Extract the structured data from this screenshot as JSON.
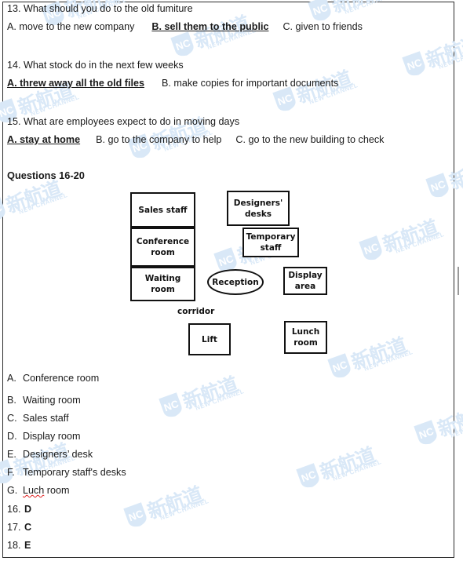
{
  "document": {
    "questions": [
      {
        "number": "13.",
        "stem": "13. What should you do to the old fumiture",
        "options": [
          {
            "label": "A. move to the new company",
            "correct": false
          },
          {
            "label": "B. sell them to the public",
            "correct": true
          },
          {
            "label": "C. given to friends",
            "correct": false
          }
        ]
      },
      {
        "number": "14.",
        "stem": "14. What stock do in the next few weeks",
        "options": [
          {
            "label": "A. threw away all the old files",
            "correct": true
          },
          {
            "label": "B. make copies for important documents",
            "correct": false
          }
        ]
      },
      {
        "number": "15.",
        "stem": "15. What are employees expect to do in moving days",
        "options": [
          {
            "label": "A. stay at home",
            "correct": true
          },
          {
            "label": "B. go to the company to help",
            "correct": false
          },
          {
            "label": "C. go to the new building to check",
            "correct": false
          }
        ]
      }
    ],
    "section_heading": "Questions 16-20",
    "diagram": {
      "boxes": [
        {
          "name": "sales-staff",
          "lines": [
            "Sales staff"
          ]
        },
        {
          "name": "conference-room",
          "lines": [
            "Conference",
            "room"
          ]
        },
        {
          "name": "waiting-room",
          "lines": [
            "Waiting",
            "room"
          ]
        },
        {
          "name": "designers-desks",
          "lines": [
            "Designers'",
            "desks"
          ]
        },
        {
          "name": "temporary-staff",
          "lines": [
            "Temporary",
            "staff"
          ]
        },
        {
          "name": "display-area",
          "lines": [
            "Display",
            "area"
          ]
        },
        {
          "name": "lift",
          "lines": [
            "Lift"
          ]
        },
        {
          "name": "lunch-room",
          "lines": [
            "Lunch",
            "room"
          ]
        }
      ],
      "ellipse": {
        "name": "reception",
        "label": "Reception"
      },
      "corridor_label": "corridor"
    },
    "option_list": [
      {
        "letter": "A.",
        "text": "Conference room"
      },
      {
        "letter": "B.",
        "text": "Waiting room"
      },
      {
        "letter": "C.",
        "text": "Sales staff"
      },
      {
        "letter": "D.",
        "text": "Display room"
      },
      {
        "letter": "E.",
        "text": "Designers’ desk"
      },
      {
        "letter": "F.",
        "text": "Temporary staff's desks"
      },
      {
        "letter": "G.",
        "text_prefix": "",
        "text_misspelled": "Luch",
        "text_suffix": " room"
      }
    ],
    "answers": [
      {
        "number": "16.",
        "answer": "D"
      },
      {
        "number": "17.",
        "answer": "C"
      },
      {
        "number": "18.",
        "answer": "E"
      }
    ],
    "watermark": {
      "chinese": "新航道",
      "english": "NEW CHANNEL",
      "initials": "NC",
      "color": "#d9e8f7"
    }
  },
  "colors": {
    "text": "#1a1a1a",
    "ink": "#111111",
    "border": "#2b2b2b",
    "spellcheck": "#e02020",
    "watermark": "#d9e8f7",
    "scrollbar": "#9a9a9a"
  }
}
